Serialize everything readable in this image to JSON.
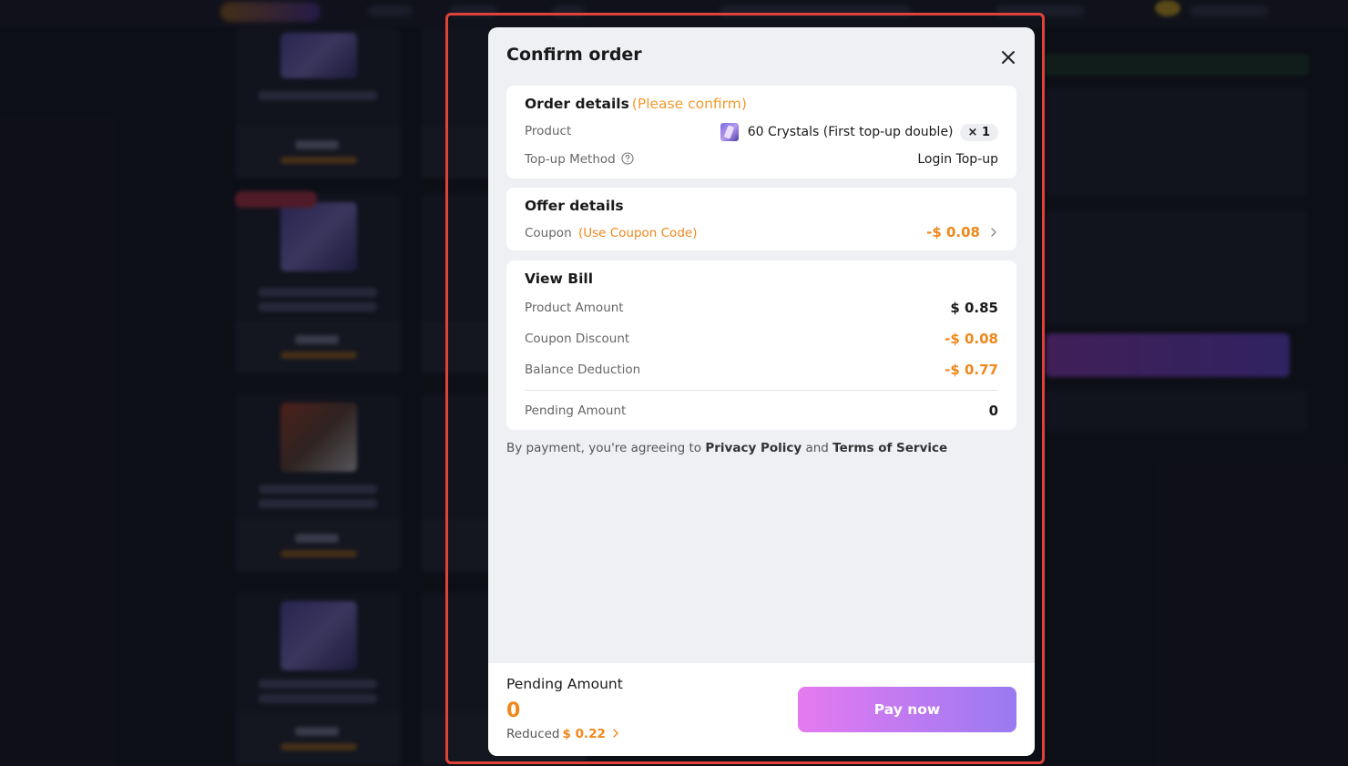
{
  "modal": {
    "title": "Confirm order",
    "close_icon": "close-icon"
  },
  "order_details": {
    "title": "Order details",
    "hint": "(Please confirm)",
    "product_label": "Product",
    "product_name": "60 Crystals (First top-up double)",
    "quantity": "× 1",
    "method_label": "Top-up Method",
    "method_value": "Login Top-up",
    "help_icon": "question-circle-icon"
  },
  "offer_details": {
    "title": "Offer details",
    "coupon_label": "Coupon",
    "coupon_hint": "(Use Coupon Code)",
    "coupon_value": "-$ 0.08",
    "chevron_icon": "chevron-right-icon"
  },
  "bill": {
    "title": "View Bill",
    "product_amount_label": "Product Amount",
    "product_amount": "$ 0.85",
    "coupon_discount_label": "Coupon Discount",
    "coupon_discount": "-$ 0.08",
    "balance_deduction_label": "Balance Deduction",
    "balance_deduction": "-$ 0.77",
    "pending_label": "Pending Amount",
    "pending_value": "0"
  },
  "agreement": {
    "prefix": "By payment, you're agreeing to ",
    "privacy": "Privacy Policy",
    "and": " and ",
    "terms": "Terms of Service"
  },
  "footer": {
    "pending_label": "Pending Amount",
    "pending_value": "0",
    "reduced_label": "Reduced",
    "reduced_value": "$ 0.22",
    "pay_button": "Pay now"
  },
  "colors": {
    "accent_orange": "#f0871a",
    "pay_gradient_start": "#e57af0",
    "pay_gradient_end": "#9a7af2",
    "focus_frame": "#e0423a"
  }
}
